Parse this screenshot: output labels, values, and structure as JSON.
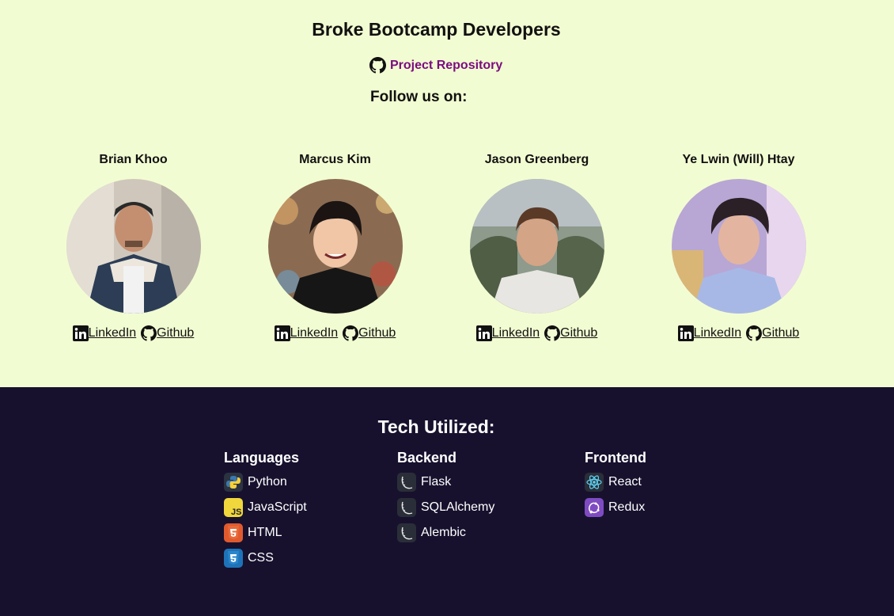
{
  "header": {
    "title": "Broke Bootcamp Developers",
    "repo_label": "Project Repository",
    "follow_label": "Follow us on:"
  },
  "developers": [
    {
      "name": "Brian Khoo",
      "linkedin": "LinkedIn",
      "github": "Github"
    },
    {
      "name": "Marcus Kim",
      "linkedin": "LinkedIn",
      "github": "Github"
    },
    {
      "name": "Jason Greenberg",
      "linkedin": "LinkedIn",
      "github": "Github"
    },
    {
      "name": "Ye Lwin (Will) Htay",
      "linkedin": "LinkedIn",
      "github": "Github"
    }
  ],
  "tech": {
    "title": "Tech Utilized:",
    "languages": {
      "heading": "Languages",
      "items": [
        {
          "label": "Python",
          "icon": "python-icon"
        },
        {
          "label": "JavaScript",
          "icon": "javascript-icon"
        },
        {
          "label": "HTML",
          "icon": "html-icon"
        },
        {
          "label": "CSS",
          "icon": "css-icon"
        }
      ]
    },
    "backend": {
      "heading": "Backend",
      "items": [
        {
          "label": "Flask",
          "icon": "flask-icon"
        },
        {
          "label": "SQLAlchemy",
          "icon": "flask-icon"
        },
        {
          "label": "Alembic",
          "icon": "flask-icon"
        }
      ]
    },
    "frontend": {
      "heading": "Frontend",
      "items": [
        {
          "label": "React",
          "icon": "react-icon"
        },
        {
          "label": "Redux",
          "icon": "redux-icon"
        }
      ]
    }
  },
  "colors": {
    "top_bg": "#f2fcd2",
    "bottom_bg": "#17112e",
    "repo_link": "#7b0d80"
  }
}
